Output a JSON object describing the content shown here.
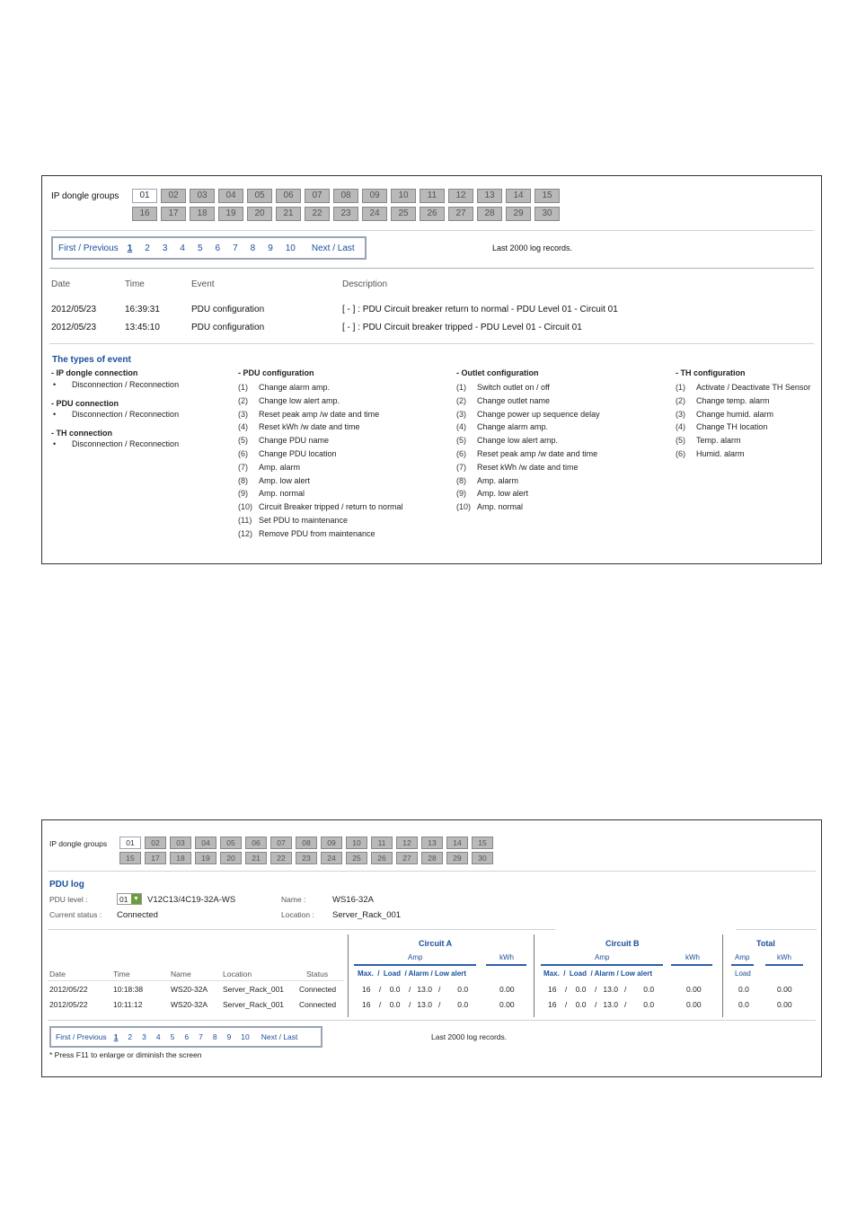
{
  "panel1": {
    "groups_label": "IP dongle groups",
    "groups_row1": [
      "01",
      "02",
      "03",
      "04",
      "05",
      "06",
      "07",
      "08",
      "09",
      "10",
      "11",
      "12",
      "13",
      "14",
      "15"
    ],
    "groups_row2": [
      "16",
      "17",
      "18",
      "19",
      "20",
      "21",
      "22",
      "23",
      "24",
      "25",
      "26",
      "27",
      "28",
      "29",
      "30"
    ],
    "pager": {
      "first_prev": "First / Previous",
      "pages": [
        "1",
        "2",
        "3",
        "4",
        "5",
        "6",
        "7",
        "8",
        "9",
        "10"
      ],
      "next_last": "Next / Last"
    },
    "records_note": "Last 2000 log records.",
    "columns": {
      "date": "Date",
      "time": "Time",
      "event": "Event",
      "description": "Description"
    },
    "rows": [
      {
        "date": "2012/05/23",
        "time": "16:39:31",
        "event": "PDU configuration",
        "description": "[ - ] : PDU Circuit breaker return to normal - PDU Level 01 - Circuit 01"
      },
      {
        "date": "2012/05/23",
        "time": "13:45:10",
        "event": "PDU configuration",
        "description": "[ - ] : PDU Circuit breaker tripped - PDU Level 01 - Circuit 01"
      }
    ],
    "types_title": "The types of event",
    "ip_conn": {
      "title": "- IP dongle connection",
      "item": "Disconnection / Reconnection"
    },
    "pdu_conn": {
      "title": "- PDU connection",
      "item": "Disconnection / Reconnection"
    },
    "th_conn": {
      "title": "- TH connection",
      "item": "Disconnection / Reconnection"
    },
    "pdu_config": {
      "title": "- PDU configuration",
      "items": [
        {
          "n": "(1)",
          "t": "Change alarm amp."
        },
        {
          "n": "(2)",
          "t": "Change low alert amp."
        },
        {
          "n": "(3)",
          "t": "Reset peak amp /w date and time"
        },
        {
          "n": "(4)",
          "t": "Reset kWh /w date and time"
        },
        {
          "n": "(5)",
          "t": "Change PDU name"
        },
        {
          "n": "(6)",
          "t": "Change PDU location"
        },
        {
          "n": "(7)",
          "t": "Amp. alarm"
        },
        {
          "n": "(8)",
          "t": "Amp. low alert"
        },
        {
          "n": "(9)",
          "t": "Amp. normal"
        },
        {
          "n": "(10)",
          "t": "Circuit Breaker tripped / return to normal"
        },
        {
          "n": "(11)",
          "t": "Set PDU to maintenance"
        },
        {
          "n": "(12)",
          "t": "Remove PDU from maintenance"
        }
      ]
    },
    "outlet_config": {
      "title": "- Outlet configuration",
      "items": [
        {
          "n": "(1)",
          "t": "Switch outlet on / off"
        },
        {
          "n": "(2)",
          "t": "Change outlet name"
        },
        {
          "n": "(3)",
          "t": "Change power up sequence delay"
        },
        {
          "n": "(4)",
          "t": "Change alarm amp."
        },
        {
          "n": "(5)",
          "t": "Change low alert amp."
        },
        {
          "n": "(6)",
          "t": "Reset peak amp /w date and time"
        },
        {
          "n": "(7)",
          "t": "Reset kWh /w date and time"
        },
        {
          "n": "(8)",
          "t": "Amp. alarm"
        },
        {
          "n": "(9)",
          "t": "Amp. low alert"
        },
        {
          "n": "(10)",
          "t": "Amp. normal"
        }
      ]
    },
    "th_config": {
      "title": "- TH configuration",
      "items": [
        {
          "n": "(1)",
          "t": "Activate / Deactivate TH Sensor"
        },
        {
          "n": "(2)",
          "t": "Change temp. alarm"
        },
        {
          "n": "(3)",
          "t": "Change humid. alarm"
        },
        {
          "n": "(4)",
          "t": "Change TH location"
        },
        {
          "n": "(5)",
          "t": "Temp. alarm"
        },
        {
          "n": "(6)",
          "t": "Humid. alarm"
        }
      ]
    }
  },
  "panel2": {
    "groups_label": "IP dongle groups",
    "groups_row1": [
      "01",
      "02",
      "03",
      "04",
      "05",
      "06",
      "07",
      "08",
      "09",
      "10",
      "11",
      "12",
      "13",
      "14",
      "15"
    ],
    "groups_row2": [
      "15",
      "17",
      "18",
      "19",
      "20",
      "21",
      "22",
      "23",
      "24",
      "25",
      "26",
      "27",
      "28",
      "29",
      "30"
    ],
    "title": "PDU log",
    "pdu_level_label": "PDU level :",
    "pdu_level_value": "01",
    "pdu_model": "V12C13/4C19-32A-WS",
    "name_label": "Name :",
    "name_value": "WS16-32A",
    "status_label": "Current status :",
    "status_value": "Connected",
    "location_label": "Location :",
    "location_value": "Server_Rack_001",
    "circuit_a": "Circuit   A",
    "circuit_b": "Circuit   B",
    "total": "Total",
    "amp": "Amp",
    "kwh": "kWh",
    "load": "Load",
    "amp_sub": "Max.  /  Load  / Alarm / Low alert",
    "columns": {
      "date": "Date",
      "time": "Time",
      "name": "Name",
      "location": "Location",
      "status": "Status"
    },
    "rows": [
      {
        "date": "2012/05/22",
        "time": "10:18:38",
        "name": "WS20-32A",
        "location": "Server_Rack_001",
        "status": "Connected",
        "a_amp": "16    /    0.0    /   13.0   /        0.0",
        "a_kwh": "0.00",
        "b_amp": "16    /    0.0    /   13.0   /        0.0",
        "b_kwh": "0.00",
        "t_load": "0.0",
        "t_kwh": "0.00"
      },
      {
        "date": "2012/05/22",
        "time": "10:11:12",
        "name": "WS20-32A",
        "location": "Server_Rack_001",
        "status": "Connected",
        "a_amp": "16    /    0.0    /   13.0   /        0.0",
        "a_kwh": "0.00",
        "b_amp": "16    /    0.0    /   13.0   /        0.0",
        "b_kwh": "0.00",
        "t_load": "0.0",
        "t_kwh": "0.00"
      }
    ],
    "pager": {
      "first_prev": "First / Previous",
      "pages": [
        "1",
        "2",
        "3",
        "4",
        "5",
        "6",
        "7",
        "8",
        "9",
        "10"
      ],
      "next_last": "Next / Last"
    },
    "records_note": "Last 2000 log records.",
    "footnote": "* Press F11 to enlarge or diminish the screen"
  }
}
